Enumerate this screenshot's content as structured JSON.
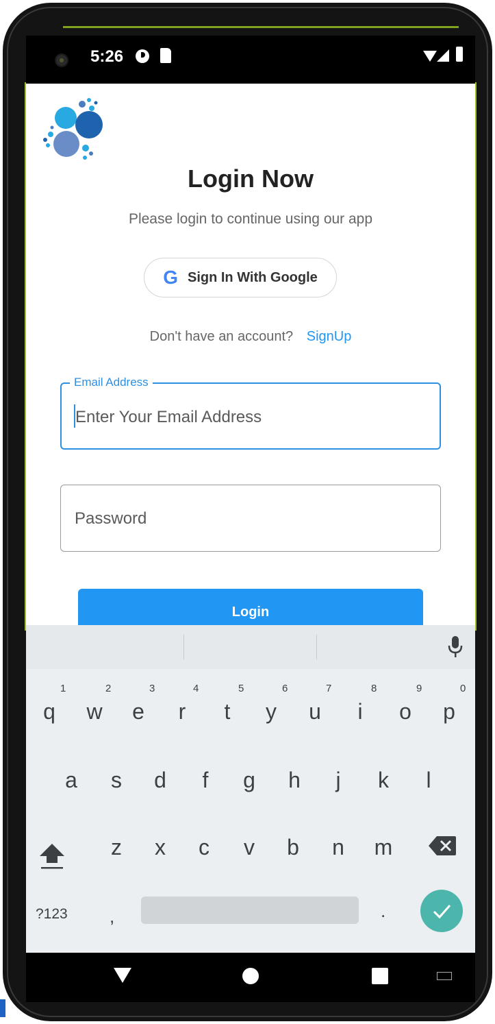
{
  "status_bar": {
    "time": "5:26"
  },
  "login": {
    "title": "Login Now",
    "subtitle": "Please login to continue using our app",
    "google_button_label": "Sign In With Google",
    "google_icon_glyph": "G",
    "signup_prompt": "Don't have an account?",
    "signup_link": "SignUp",
    "email": {
      "label": "Email Address",
      "placeholder": "Enter Your Email Address",
      "value": ""
    },
    "password": {
      "placeholder": "Password",
      "value": ""
    },
    "login_button": "Login"
  },
  "keyboard": {
    "row1": [
      "q",
      "w",
      "e",
      "r",
      "t",
      "y",
      "u",
      "i",
      "o",
      "p"
    ],
    "row1_hints": [
      "1",
      "2",
      "3",
      "4",
      "5",
      "6",
      "7",
      "8",
      "9",
      "0"
    ],
    "row2": [
      "a",
      "s",
      "d",
      "f",
      "g",
      "h",
      "j",
      "k",
      "l"
    ],
    "row3": [
      "z",
      "x",
      "c",
      "v",
      "b",
      "n",
      "m"
    ],
    "num_key": "?123",
    "comma": ",",
    "period": "."
  },
  "colors": {
    "accent": "#2196F3",
    "field_focus": "#2d8fe0",
    "enter_key": "#4db6ac",
    "keyboard_bg": "#eceff1"
  },
  "icons": {
    "logo": "bubble-cluster-logo",
    "google": "google-g-icon",
    "mic": "microphone-icon",
    "shift": "shift-arrow-icon",
    "backspace": "backspace-icon",
    "enter": "checkmark-icon"
  }
}
